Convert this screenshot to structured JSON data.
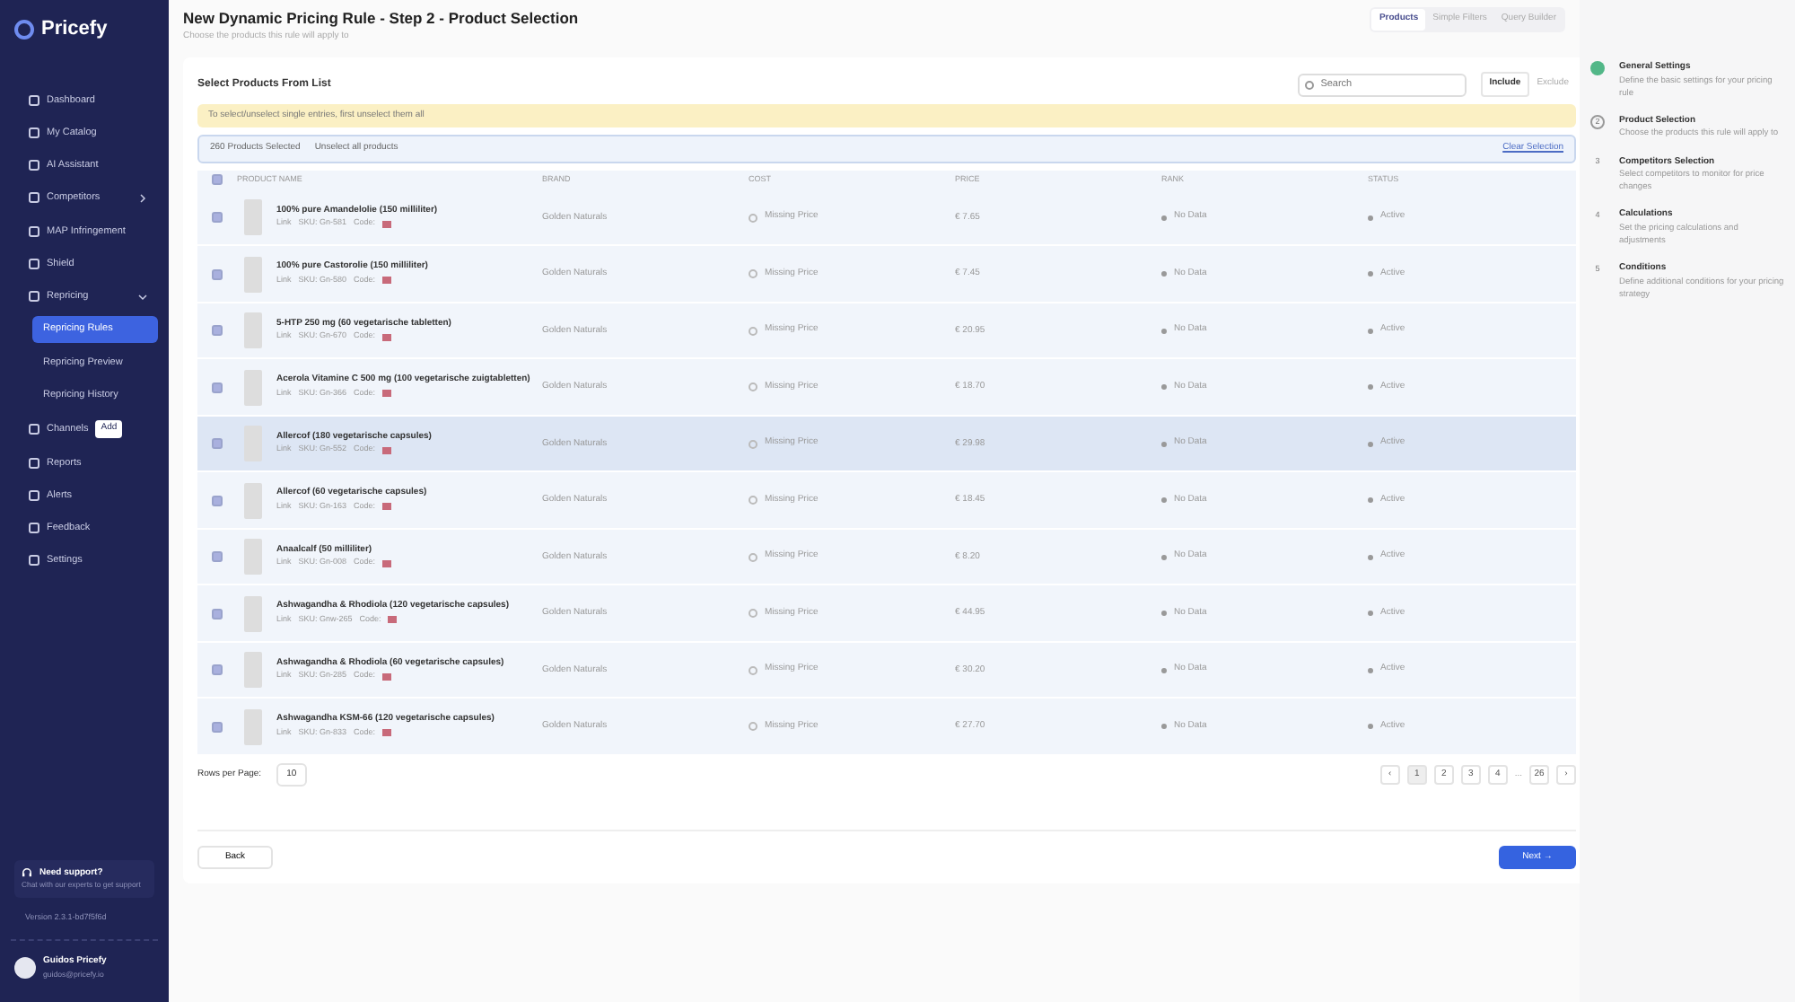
{
  "sidebar": {
    "logo": "Pricefy",
    "items": [
      {
        "label": "Dashboard",
        "selected": false
      },
      {
        "label": "My Catalog",
        "selected": false
      },
      {
        "label": "AI Assistant",
        "selected": false
      },
      {
        "label": "Competitors",
        "selected": false,
        "expanded": false
      },
      {
        "label": "MAP Infringement",
        "selected": false
      },
      {
        "label": "Shield",
        "selected": false
      },
      {
        "label": "Repricing",
        "selected": false,
        "expanded": true,
        "children": [
          {
            "label": "Repricing Rules",
            "selected": true
          },
          {
            "label": "Repricing Preview",
            "selected": false
          },
          {
            "label": "Repricing History",
            "selected": false
          }
        ]
      },
      {
        "label": "Channels",
        "selected": false,
        "badge": "Add"
      },
      {
        "label": "Reports",
        "selected": false
      },
      {
        "label": "Alerts",
        "selected": false
      },
      {
        "label": "Feedback",
        "selected": false
      },
      {
        "label": "Settings",
        "selected": false
      }
    ],
    "support": {
      "title": "Need support?",
      "link": "Chat",
      "text": "with our experts to get support"
    },
    "version": "Version 2.3.1-bd7f5f6d",
    "user": {
      "name": "Guidos Pricefy",
      "email": "guidos@pricefy.io"
    }
  },
  "header": {
    "title": "New Dynamic Pricing Rule - Step 2 - Product Selection",
    "subtitle": "Choose the products this rule will apply to",
    "tabs": [
      {
        "label": "Products",
        "selected": true
      },
      {
        "label": "Simple Filters",
        "selected": false
      },
      {
        "label": "Query Builder",
        "selected": false
      }
    ]
  },
  "section_title": "Select Products From List",
  "search": {
    "placeholder": "Search"
  },
  "mode": [
    {
      "label": "Include",
      "selected": true
    },
    {
      "label": "Exclude",
      "selected": false
    }
  ],
  "notice": "To select/unselect single entries, first unselect them all",
  "selection": {
    "count": "260 Products Selected",
    "unselect": "Unselect all products",
    "clear": "Clear Selection"
  },
  "table": {
    "all_checked": true,
    "columns": [
      "PRODUCT NAME",
      "BRAND",
      "COST",
      "PRICE",
      "RANK",
      "STATUS"
    ],
    "rows": [
      {
        "checked": true,
        "hover": false,
        "name": "100% pure Amandelolie (150 milliliter)",
        "link": "Link",
        "sku": "SKU: Gn-581",
        "code": "Code:",
        "brand": "Golden Naturals",
        "cost": "Missing Price",
        "price": "€ 7.65",
        "rank": "No Data",
        "status": "Active"
      },
      {
        "checked": true,
        "hover": false,
        "name": "100% pure Castorolie (150 milliliter)",
        "link": "Link",
        "sku": "SKU: Gn-580",
        "code": "Code:",
        "brand": "Golden Naturals",
        "cost": "Missing Price",
        "price": "€ 7.45",
        "rank": "No Data",
        "status": "Active"
      },
      {
        "checked": true,
        "hover": false,
        "name": "5-HTP 250 mg (60 vegetarische tabletten)",
        "link": "Link",
        "sku": "SKU: Gn-670",
        "code": "Code:",
        "brand": "Golden Naturals",
        "cost": "Missing Price",
        "price": "€ 20.95",
        "rank": "No Data",
        "status": "Active"
      },
      {
        "checked": true,
        "hover": false,
        "name": "Acerola Vitamine C 500 mg (100 vegetarische zuigtabletten)",
        "link": "Link",
        "sku": "SKU: Gn-366",
        "code": "Code:",
        "brand": "Golden Naturals",
        "cost": "Missing Price",
        "price": "€ 18.70",
        "rank": "No Data",
        "status": "Active"
      },
      {
        "checked": true,
        "hover": true,
        "name": "Allercof (180 vegetarische capsules)",
        "link": "Link",
        "sku": "SKU: Gn-552",
        "code": "Code:",
        "brand": "Golden Naturals",
        "cost": "Missing Price",
        "price": "€ 29.98",
        "rank": "No Data",
        "status": "Active"
      },
      {
        "checked": true,
        "hover": false,
        "name": "Allercof (60 vegetarische capsules)",
        "link": "Link",
        "sku": "SKU: Gn-163",
        "code": "Code:",
        "brand": "Golden Naturals",
        "cost": "Missing Price",
        "price": "€ 18.45",
        "rank": "No Data",
        "status": "Active"
      },
      {
        "checked": true,
        "hover": false,
        "name": "Anaalcalf (50 milliliter)",
        "link": "Link",
        "sku": "SKU: Gn-008",
        "code": "Code:",
        "brand": "Golden Naturals",
        "cost": "Missing Price",
        "price": "€ 8.20",
        "rank": "No Data",
        "status": "Active"
      },
      {
        "checked": true,
        "hover": false,
        "name": "Ashwagandha & Rhodiola (120 vegetarische capsules)",
        "link": "Link",
        "sku": "SKU: Gnw-265",
        "code": "Code:",
        "brand": "Golden Naturals",
        "cost": "Missing Price",
        "price": "€ 44.95",
        "rank": "No Data",
        "status": "Active"
      },
      {
        "checked": true,
        "hover": false,
        "name": "Ashwagandha & Rhodiola (60 vegetarische capsules)",
        "link": "Link",
        "sku": "SKU: Gn-285",
        "code": "Code:",
        "brand": "Golden Naturals",
        "cost": "Missing Price",
        "price": "€ 30.20",
        "rank": "No Data",
        "status": "Active"
      },
      {
        "checked": true,
        "hover": false,
        "name": "Ashwagandha KSM-66 (120 vegetarische capsules)",
        "link": "Link",
        "sku": "SKU: Gn-833",
        "code": "Code:",
        "brand": "Golden Naturals",
        "cost": "Missing Price",
        "price": "€ 27.70",
        "rank": "No Data",
        "status": "Active"
      }
    ]
  },
  "rows_per_page": {
    "label": "Rows per Page:",
    "value": "10"
  },
  "pagination": [
    {
      "kind": "page",
      "label": "‹",
      "selected": false
    },
    {
      "kind": "page",
      "label": "1",
      "selected": true
    },
    {
      "kind": "page",
      "label": "2",
      "selected": false
    },
    {
      "kind": "page",
      "label": "3",
      "selected": false
    },
    {
      "kind": "page",
      "label": "4",
      "selected": false
    },
    {
      "kind": "ellipsis",
      "label": "..."
    },
    {
      "kind": "page",
      "label": "26",
      "selected": false
    },
    {
      "kind": "page",
      "label": "›",
      "selected": false
    }
  ],
  "back": "Back",
  "next": "Next →",
  "steps": [
    {
      "title": "General Settings",
      "text": "Define the basic settings for your pricing rule",
      "completed": true,
      "selected": false
    },
    {
      "number": "2",
      "title": "Product Selection",
      "text": "Choose the products this rule will apply to",
      "completed": false,
      "selected": true
    },
    {
      "number": "3",
      "title": "Competitors Selection",
      "text": "Select competitors to monitor for price changes",
      "completed": false,
      "selected": false
    },
    {
      "number": "4",
      "title": "Calculations",
      "text": "Set the pricing calculations and adjustments",
      "completed": false,
      "selected": false
    },
    {
      "number": "5",
      "title": "Conditions",
      "text": "Define additional conditions for your pricing strategy",
      "completed": false,
      "selected": false
    }
  ]
}
